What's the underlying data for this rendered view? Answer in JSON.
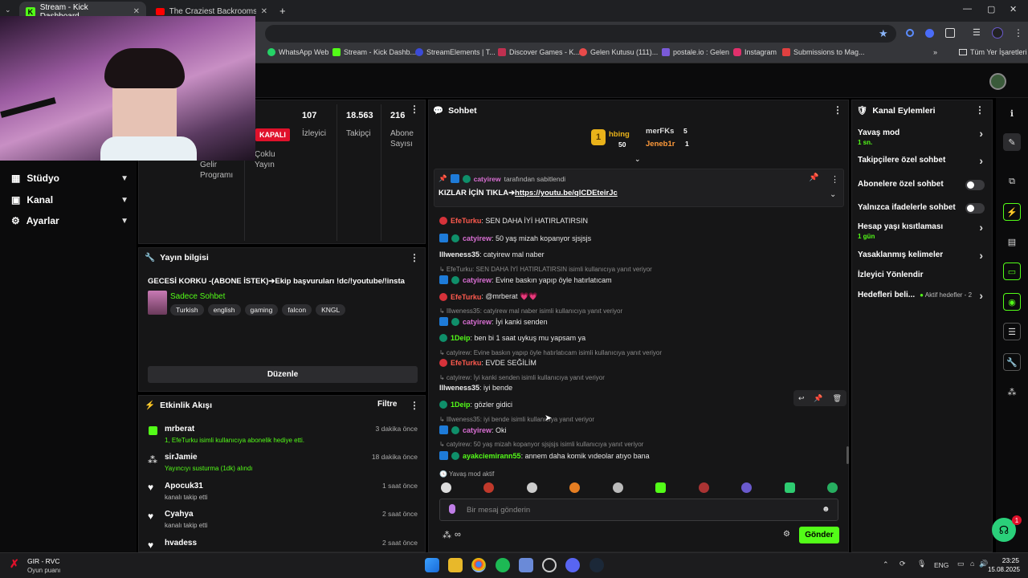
{
  "browser": {
    "tabs": [
      {
        "label": "Stream - Kick Dashboard",
        "active": true
      },
      {
        "label": "The Craziest Backrooms Dap - Y",
        "active": false
      }
    ],
    "bookmarks": [
      "WhatsApp Web",
      "Stream - Kick Dashb...",
      "StreamElements | T...",
      "Discover Games - K...",
      "Gelen Kutusu (111)...",
      "postale.io : Gelen",
      "Instagram",
      "Submissions to Mag..."
    ],
    "all_bookmarks": "Tüm Yer İşaretleri"
  },
  "sidebar": {
    "items": [
      {
        "label": "Stüdyo"
      },
      {
        "label": "Kanal"
      },
      {
        "label": "Ayarlar"
      }
    ]
  },
  "stats": {
    "status_badge": "KAPALI",
    "status_label": "Çoklu Yayın",
    "income_label": "Gelir Programı",
    "items": [
      {
        "value": "107",
        "label": "İzleyici"
      },
      {
        "value": "18.563",
        "label": "Takipçi"
      },
      {
        "value": "216",
        "label": "Abone Sayısı"
      }
    ]
  },
  "stream_info": {
    "title": "Yayın bilgisi",
    "stream_title": "GECESİ KORKU -(ABONE İSTEK)➔Ekip başvuruları !dc/!youtube/!insta",
    "category": "Sadece Sohbet",
    "tags": [
      "Turkish",
      "english",
      "gaming",
      "falcon",
      "KNGL"
    ],
    "edit_label": "Düzenle"
  },
  "activity": {
    "title": "Etkinlik Akışı",
    "filter_label": "Filtre",
    "events": [
      {
        "name": "mrberat",
        "sub": "1, EfeTurku isimli kullanıcıya abonelik hediye etti.",
        "time": "3 dakika önce",
        "icon": "gift-icon"
      },
      {
        "name": "sirJamie",
        "sub": "Yayıncıyı susturma (1dk) alındı",
        "time": "18 dakika önce",
        "icon": "kick-coin-icon"
      },
      {
        "name": "Apocuk31",
        "sub": "kanalı takip etti",
        "time": "1 saat önce",
        "icon": "heart-icon"
      },
      {
        "name": "Cyahya",
        "sub": "kanalı takip etti",
        "time": "2 saat önce",
        "icon": "heart-icon"
      },
      {
        "name": "hvadess",
        "sub": "",
        "time": "2 saat önce",
        "icon": "heart-icon"
      }
    ]
  },
  "chat": {
    "title": "Sohbet",
    "leaderboard": [
      {
        "name": "hbing",
        "value": "50"
      },
      {
        "name": "merFKs",
        "value": "5"
      },
      {
        "name": "Jeneb1r",
        "value": "1"
      }
    ],
    "pinned": {
      "by": "catyirew",
      "by_suffix": "tarafından sabitlendi",
      "text": "KIZLAR İÇİN TIKLA➔",
      "link": "https://youtu.be/qlCDEteirJc"
    },
    "messages": [
      {
        "type": "msg",
        "user": "EfeTurku",
        "text": ": SEN DAHA İYİ HATIRLATIRSIN",
        "ucls": "u-efe"
      },
      {
        "type": "msg",
        "user": "catyirew",
        "text": ": 50 yaş mizah kopanyor sjsjsjs",
        "ucls": "u-cat"
      },
      {
        "type": "msg",
        "user": "Illweness35",
        "text": ": catyirew mal naber",
        "ucls": "u-ill"
      },
      {
        "type": "reply",
        "text": "EfeTurku: SEN DAHA İYİ HATIRLATIRSIN isimli kullanıcıya yanıt veriyor"
      },
      {
        "type": "msg",
        "user": "catyirew",
        "text": ": Evine baskın yapıp öyle hatırlatıcam",
        "ucls": "u-cat"
      },
      {
        "type": "msg",
        "user": "EfeTurku",
        "text": ": @mrberat 💗💗",
        "ucls": "u-efe"
      },
      {
        "type": "reply",
        "text": "Illweness35: catyirew mal naber isimli kullanıcıya yanıt veriyor"
      },
      {
        "type": "msg",
        "user": "catyirew",
        "text": ": İyi kanki senden",
        "ucls": "u-cat"
      },
      {
        "type": "msg",
        "user": "1Deip",
        "text": ": ben bi 1 saat uykuş mu yapsam ya",
        "ucls": "u-deip"
      },
      {
        "type": "reply",
        "text": "catyirew: Evine baskın yapıp öyle hatırlatıcam isimli kullanıcıya yanıt veriyor"
      },
      {
        "type": "msg",
        "user": "EfeTurku",
        "text": ": EVDE SEĞİLİM",
        "ucls": "u-efe"
      },
      {
        "type": "reply",
        "text": "catyirew: İyi kanki senden isimli kullanıcıya yanıt veriyor"
      },
      {
        "type": "msg",
        "user": "Illweness35",
        "text": ": iyi bende",
        "ucls": "u-ill"
      },
      {
        "type": "msg",
        "user": "1Deip",
        "text": ": gözler gidici",
        "ucls": "u-deip"
      },
      {
        "type": "reply",
        "text": "Illweness35: iyi bende isimli kullanıcıya yanıt veriyor"
      },
      {
        "type": "msg",
        "user": "catyirew",
        "text": ": Oki",
        "ucls": "u-cat"
      },
      {
        "type": "reply",
        "text": "catyirew: 50 yaş mizah kopanyor sjsjsjs isimli kullanıcıya yanıt veriyor"
      },
      {
        "type": "msg",
        "user": "ayakciemirann55",
        "text": ": annem daha komik vıdeolar atıyo bana",
        "ucls": "u-aya"
      }
    ],
    "slow_mode": "Yavaş mod aktif",
    "input_placeholder": "Bir mesaj gönderin",
    "send_label": "Gönder"
  },
  "channel_actions": {
    "title": "Kanal Eylemleri",
    "items": [
      {
        "label": "Yavaş mod",
        "sub": "1 sn.",
        "control": "chevron"
      },
      {
        "label": "Takipçilere özel sohbet",
        "sub": "",
        "control": "chevron"
      },
      {
        "label": "Abonelere özel sohbet",
        "sub": "",
        "control": "toggle"
      },
      {
        "label": "Yalnızca ifadelerle sohbet",
        "sub": "",
        "control": "toggle"
      },
      {
        "label": "Hesap yaşı kısıtlaması",
        "sub": "1 gün",
        "control": "chevron"
      },
      {
        "label": "Yasaklanmış kelimeler",
        "sub": "",
        "control": "chevron"
      },
      {
        "label": "İzleyici Yönlendir",
        "sub": "",
        "control": "none"
      },
      {
        "label": "Hedefleri beli...",
        "sub": "",
        "control": "chevron",
        "extra": "Aktif hedefler - 2"
      }
    ]
  },
  "taskbar": {
    "game_title": "GIR - RVC",
    "game_sub": "Oyun puanı",
    "lang": "ENG",
    "time": "23:25",
    "date": "15.08.2025"
  },
  "notification_count": "1",
  "colors": {
    "accent": "#53fc18",
    "live_badge": "#e0112b",
    "panel": "#161617"
  }
}
